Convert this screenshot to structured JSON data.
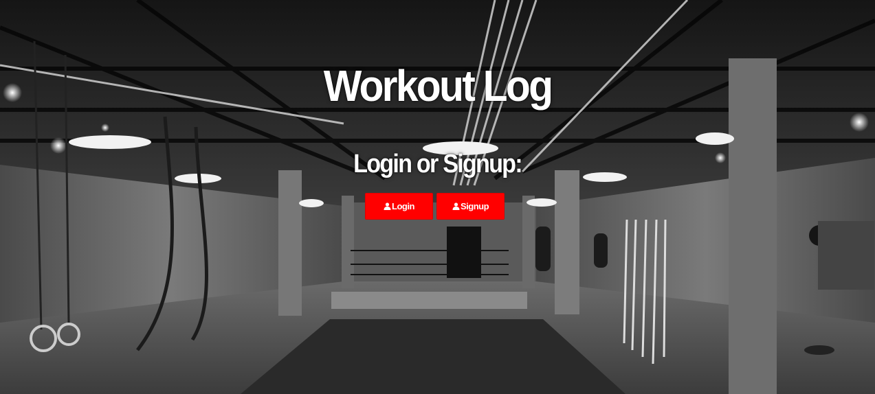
{
  "page": {
    "title": "Workout Log",
    "subtitle": "Login or Signup:"
  },
  "buttons": {
    "login_label": "Login",
    "signup_label": "Signup",
    "login_icon": "user-icon",
    "signup_icon": "user-icon"
  },
  "colors": {
    "button_bg": "#ff0000",
    "text": "#ffffff"
  }
}
